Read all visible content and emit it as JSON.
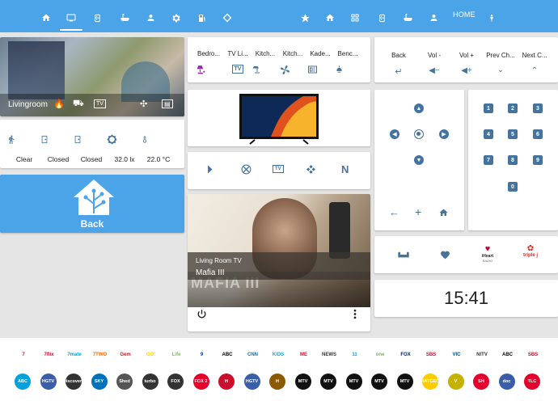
{
  "topbar": {
    "left_icons": [
      "home-icon",
      "tv-icon",
      "fridge-icon",
      "bath-icon",
      "baby-icon",
      "gear-icon",
      "gas-icon",
      "tag-icon"
    ],
    "right_icons": [
      "star-icon",
      "home-icon",
      "dashboard-icon",
      "fridge-icon",
      "bath-icon",
      "baby-icon"
    ],
    "home_label": "HOME",
    "person_icon": "person-icon",
    "accent": "#4ba3e8"
  },
  "camera": {
    "name": "Livingroom",
    "icons": [
      "flame-icon",
      "vacuum-icon",
      "tv-icon",
      "fan-icon",
      "tablet-icon"
    ]
  },
  "sensors": [
    {
      "icon": "walk-icon",
      "value": "Clear"
    },
    {
      "icon": "door-icon",
      "value": "Closed"
    },
    {
      "icon": "door-icon",
      "value": "Closed"
    },
    {
      "icon": "brightness-icon",
      "value": "32.0 lx"
    },
    {
      "icon": "thermometer-icon",
      "value": "22.0 °C"
    }
  ],
  "back_button": {
    "label": "Back"
  },
  "entities": [
    {
      "name": "Bedro...",
      "icon": "lamp-icon",
      "color": "#9c27b0"
    },
    {
      "name": "TV Li...",
      "icon": "tv-icon",
      "color": "#44739e"
    },
    {
      "name": "Kitch...",
      "icon": "desk-lamp-icon",
      "color": "#44739e"
    },
    {
      "name": "Kitch...",
      "icon": "fan-icon",
      "color": "#44739e"
    },
    {
      "name": "Kade...",
      "icon": "tablet-icon",
      "color": "#44739e"
    },
    {
      "name": "Benc...",
      "icon": "bell-lamp-icon",
      "color": "#44739e"
    }
  ],
  "sources": [
    "playstation-icon",
    "xbox-icon",
    "tv-icon",
    "kodi-icon",
    "netflix-icon"
  ],
  "sources_netflix_letter": "N",
  "media": {
    "device": "Living Room TV",
    "title": "Mafia III",
    "poster_title": "MAFIA III"
  },
  "controls": [
    {
      "label": "Back",
      "icon": "return-icon"
    },
    {
      "label": "Vol -",
      "icon": "volume-minus-icon"
    },
    {
      "label": "Vol +",
      "icon": "volume-plus-icon"
    },
    {
      "label": "Prev Ch...",
      "icon": "chevron-down-icon"
    },
    {
      "label": "Next C...",
      "icon": "chevron-up-icon"
    }
  ],
  "numpad": [
    "1",
    "2",
    "3",
    "4",
    "5",
    "6",
    "7",
    "8",
    "9",
    "0"
  ],
  "dpad": {
    "back_icon": "arrow-left-icon",
    "plus_icon": "plus-icon",
    "home_icon": "home-icon"
  },
  "favorites": [
    {
      "icon": "couch-icon"
    },
    {
      "icon": "heart-icon"
    },
    {
      "label": "iHeart",
      "sublabel": "RADIO"
    },
    {
      "label": "triple j"
    }
  ],
  "clock": "15:41",
  "channels_row1": [
    "7",
    "7flix",
    "7mate",
    "7TWO",
    "Gem",
    "GO!",
    "Life",
    "9",
    "ABC",
    "CNN",
    "KIDS",
    "ME",
    "NEWS",
    "11",
    "one",
    "FOX",
    "SBS",
    "VIC",
    "NITV",
    "ABC",
    "SBS"
  ],
  "channels_row2": [
    "ABC",
    "HGTV",
    "Discovery",
    "SKY",
    "Shed",
    "turbo",
    "FOX",
    "FOX 2",
    "H",
    "HGTV",
    "H",
    "MTV",
    "MTV",
    "MTV",
    "MTV",
    "MTV",
    "NATGEO",
    "V",
    "SH",
    "doc",
    "TLC"
  ]
}
